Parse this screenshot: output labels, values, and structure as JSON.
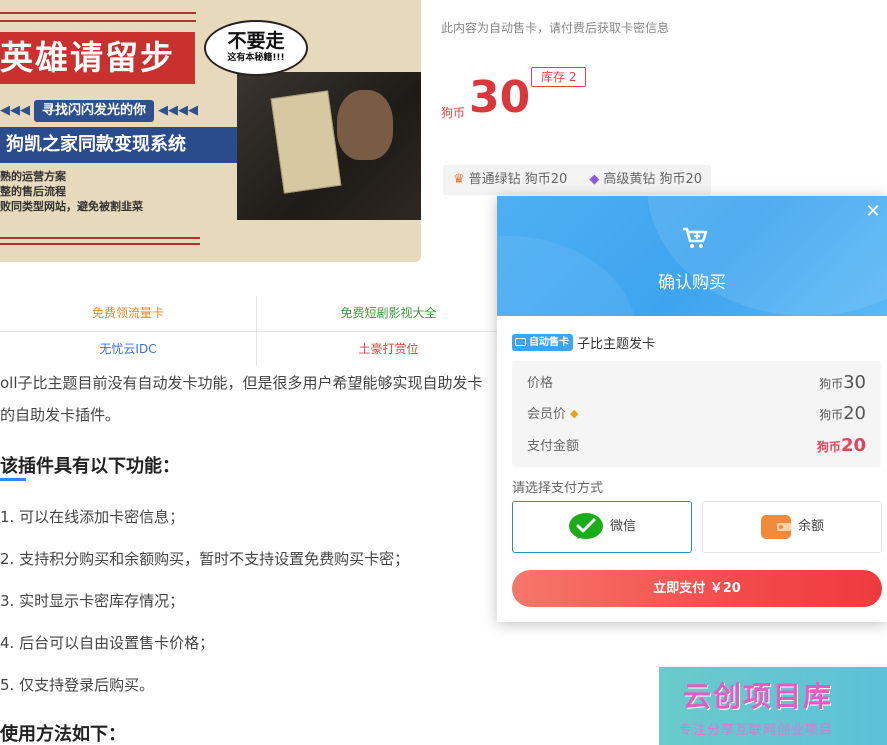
{
  "banner": {
    "title": "英雄请留步",
    "bubble_main": "不要走",
    "bubble_sub": "这有本秘籍!!!",
    "find_left": "◀◀◀",
    "find_mid": "寻找闪闪发光的你",
    "find_right": "◀◀◀◀",
    "subtitle": "狗凯之家同款变现系统",
    "lines": [
      "熟的运营方案",
      "整的售后流程",
      "败同类型网站，避免被割韭菜"
    ]
  },
  "product": {
    "notice": "此内容为自动售卡，请付费后获取卡密信息",
    "currency": "狗币",
    "price": "30",
    "stock": "库存 2",
    "tier_normal": "普通绿钻 狗币20",
    "tier_senior": "高级黄钻 狗币20",
    "colors": {
      "price": "#d9373c",
      "accent": "#3ea4ef"
    }
  },
  "links": {
    "row1": [
      "免费领流量卡",
      "免费短剧影视大全"
    ],
    "row2": [
      "无忧云IDC",
      "土豪打赏位"
    ]
  },
  "article": {
    "p1": "oll子比主题目前没有自动发卡功能，但是很多用户希望能够实现自助发卡",
    "p2": "的自助发卡插件。",
    "heading1": "该插件具有以下功能：",
    "items": [
      "1. 可以在线添加卡密信息；",
      "2. 支持积分购买和余额购买，暂时不支持设置免费购买卡密；",
      "3. 实时显示卡密库存情况；",
      "4. 后台可以自由设置售卡价格；",
      "5. 仅支持登录后购买。"
    ],
    "heading2": "使用方法如下："
  },
  "modal": {
    "title": "确认购买",
    "badge": "自动售卡",
    "product_name": "子比主题发卡",
    "rows": {
      "price": {
        "label": "价格",
        "unit": "狗币",
        "value": "30"
      },
      "member": {
        "label": "会员价",
        "unit": "狗币",
        "value": "20"
      },
      "pay": {
        "label": "支付金额",
        "unit": "狗币",
        "value": "20"
      }
    },
    "method_label": "请选择支付方式",
    "methods": {
      "wechat": "微信",
      "balance": "余额"
    },
    "pay_button": "立即支付  ￥20",
    "icons": {
      "close": "close-icon",
      "cart": "cart-icon",
      "vip": "diamond-icon"
    }
  },
  "watermark": {
    "main": "云创项目库",
    "sub": "专注分享互联网创业项目"
  }
}
